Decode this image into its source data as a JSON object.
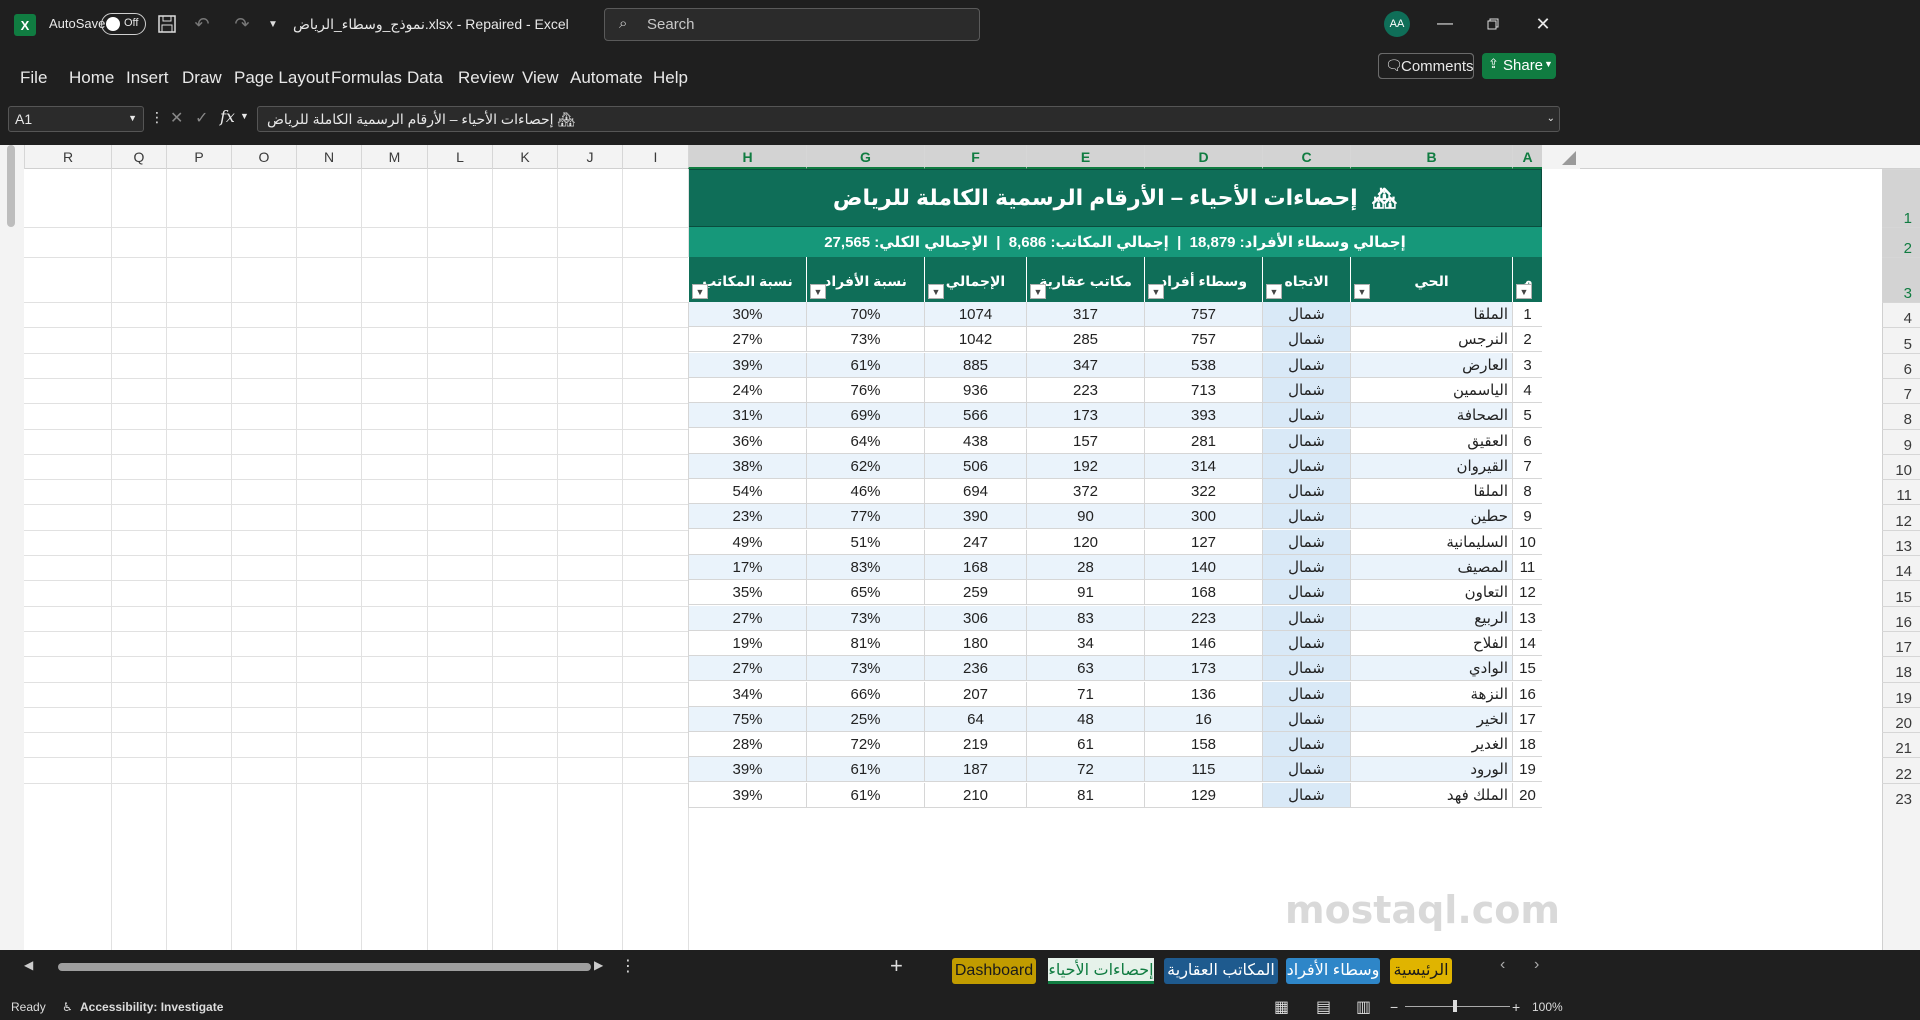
{
  "titlebar": {
    "autosave_label": "AutoSave",
    "autosave_state": "Off",
    "doc_title": "نموذج_وسطاء_الرياض.xlsx - Repaired - Excel",
    "search_placeholder": "Search",
    "avatar_initials": "AA"
  },
  "menu": {
    "items": [
      "File",
      "Home",
      "Insert",
      "Draw",
      "Page Layout",
      "Formulas",
      "Data",
      "Review",
      "View",
      "Automate",
      "Help"
    ],
    "comments": "Comments",
    "share": "Share"
  },
  "formula": {
    "namebox": "A1",
    "fx": "fx",
    "content": "🏘 إحصاءات الأحياء – الأرقام الرسمية الكاملة للرياض"
  },
  "columns": [
    "R",
    "Q",
    "P",
    "O",
    "N",
    "M",
    "L",
    "K",
    "J",
    "I",
    "H",
    "G",
    "F",
    "E",
    "D",
    "C",
    "B",
    "A"
  ],
  "selected_columns": [
    "A",
    "B",
    "C",
    "D",
    "E",
    "F",
    "G",
    "H"
  ],
  "row_numbers": [
    "1",
    "2",
    "3",
    "4",
    "5",
    "6",
    "7",
    "8",
    "9",
    "10",
    "11",
    "12",
    "13",
    "14",
    "15",
    "16",
    "17",
    "18",
    "19",
    "20",
    "21",
    "22",
    "23"
  ],
  "sheet": {
    "title": "إحصاءات الأحياء – الأرقام الرسمية الكاملة للرياض",
    "title_icon": "house-icon",
    "summary": "إجمالي وسطاء الأفراد: 18,879  |  إجمالي المكاتب: 8,686  |  الإجمالي الكلي: 27,565",
    "headers": [
      "م",
      "الحي",
      "الاتجاه",
      "وسطاء أفراد",
      "مكاتب عقارية",
      "الإجمالي",
      "نسبة الأفراد",
      "نسبة المكاتب"
    ],
    "rows": [
      [
        "1",
        "الملقا",
        "شمال",
        "757",
        "317",
        "1074",
        "70%",
        "30%"
      ],
      [
        "2",
        "النرجس",
        "شمال",
        "757",
        "285",
        "1042",
        "73%",
        "27%"
      ],
      [
        "3",
        "العارض",
        "شمال",
        "538",
        "347",
        "885",
        "61%",
        "39%"
      ],
      [
        "4",
        "الياسمين",
        "شمال",
        "713",
        "223",
        "936",
        "76%",
        "24%"
      ],
      [
        "5",
        "الصحافة",
        "شمال",
        "393",
        "173",
        "566",
        "69%",
        "31%"
      ],
      [
        "6",
        "العقيق",
        "شمال",
        "281",
        "157",
        "438",
        "64%",
        "36%"
      ],
      [
        "7",
        "القيروان",
        "شمال",
        "314",
        "192",
        "506",
        "62%",
        "38%"
      ],
      [
        "8",
        "الملقا",
        "شمال",
        "322",
        "372",
        "694",
        "46%",
        "54%"
      ],
      [
        "9",
        "حطين",
        "شمال",
        "300",
        "90",
        "390",
        "77%",
        "23%"
      ],
      [
        "10",
        "السليمانية",
        "شمال",
        "127",
        "120",
        "247",
        "51%",
        "49%"
      ],
      [
        "11",
        "المصيف",
        "شمال",
        "140",
        "28",
        "168",
        "83%",
        "17%"
      ],
      [
        "12",
        "التعاون",
        "شمال",
        "168",
        "91",
        "259",
        "65%",
        "35%"
      ],
      [
        "13",
        "الربيع",
        "شمال",
        "223",
        "83",
        "306",
        "73%",
        "27%"
      ],
      [
        "14",
        "الفلاح",
        "شمال",
        "146",
        "34",
        "180",
        "81%",
        "19%"
      ],
      [
        "15",
        "الوادي",
        "شمال",
        "173",
        "63",
        "236",
        "73%",
        "27%"
      ],
      [
        "16",
        "النزهة",
        "شمال",
        "136",
        "71",
        "207",
        "66%",
        "34%"
      ],
      [
        "17",
        "الخير",
        "شمال",
        "16",
        "48",
        "64",
        "25%",
        "75%"
      ],
      [
        "18",
        "الغدير",
        "شمال",
        "158",
        "61",
        "219",
        "72%",
        "28%"
      ],
      [
        "19",
        "الورود",
        "شمال",
        "115",
        "72",
        "187",
        "61%",
        "39%"
      ],
      [
        "20",
        "الملك فهد",
        "شمال",
        "129",
        "81",
        "210",
        "61%",
        "39%"
      ]
    ]
  },
  "tabs": [
    {
      "label": "Dashboard",
      "bg": "#c19c00",
      "fg": "#1a1a1a",
      "active": false
    },
    {
      "label": "إحصاءات الأحياء",
      "bg": "#e6f2ea",
      "fg": "#107c41",
      "active": true
    },
    {
      "label": "المكاتب العقارية",
      "bg": "#1e5a8e",
      "fg": "#ffffff",
      "active": false
    },
    {
      "label": "وسطاء الأفراد",
      "bg": "#2e86c8",
      "fg": "#ffffff",
      "active": false
    },
    {
      "label": "الرئيسية",
      "bg": "#e0b400",
      "fg": "#1a1a1a",
      "active": false
    }
  ],
  "status": {
    "ready": "Ready",
    "accessibility": "Accessibility: Investigate",
    "zoom": "100%"
  },
  "watermark": "mostaql.com",
  "colors": {
    "accent": "#107c41",
    "header": "#0f6e58",
    "summary": "#16987a",
    "band": "#eaf3fb",
    "dir": "#d9e9f7"
  }
}
